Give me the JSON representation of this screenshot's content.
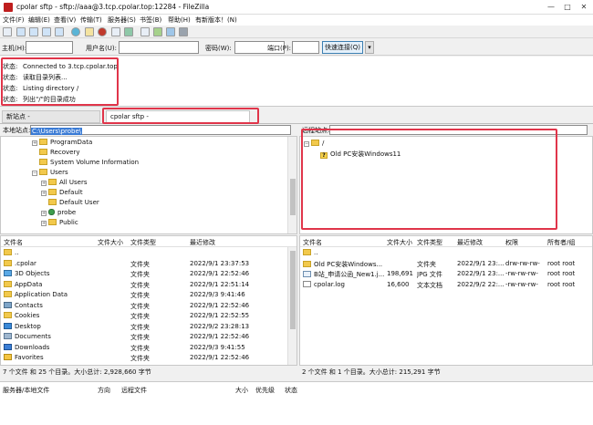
{
  "window": {
    "title": "cpolar sftp - sftp://aaa@3.tcp.cpolar.top:12284 - FileZilla",
    "controls": [
      "—",
      "□",
      "✕"
    ]
  },
  "menu": [
    "文件(F)",
    "编辑(E)",
    "查看(V)",
    "传输(T)",
    "服务器(S)",
    "书签(B)",
    "帮助(H)",
    "有新版本！(N)"
  ],
  "quickconnect": {
    "host_label": "主机(H):",
    "user_label": "用户名(U):",
    "pass_label": "密码(W):",
    "port_label": "端口(P):",
    "connect_label": "快速连接(Q)",
    "dropdown": "▾"
  },
  "log": [
    {
      "k": "状态:",
      "v": "Connected to 3.tcp.cpolar.top"
    },
    {
      "k": "状态:",
      "v": "读取目录列表..."
    },
    {
      "k": "状态:",
      "v": "Listing directory /"
    },
    {
      "k": "状态:",
      "v": "列出\"/\"的目录成功"
    }
  ],
  "tabs": [
    {
      "label": "新站点 - sftp://aaa@127.0.0.1",
      "active": false
    },
    {
      "label": "cpolar sftp - sftp://aaa@3.tcp.cpolar.top:12284",
      "active": true
    }
  ],
  "local": {
    "site_label": "本地站点:",
    "path": "C:\\Users\\probe\\",
    "tree": [
      {
        "name": "ProgramData",
        "indent": 1,
        "exp": "+"
      },
      {
        "name": "Recovery",
        "indent": 1,
        "exp": ""
      },
      {
        "name": "System Volume Information",
        "indent": 1,
        "exp": ""
      },
      {
        "name": "Users",
        "indent": 1,
        "exp": "−"
      },
      {
        "name": "All Users",
        "indent": 2,
        "exp": "+"
      },
      {
        "name": "Default",
        "indent": 2,
        "exp": "+"
      },
      {
        "name": "Default User",
        "indent": 2,
        "exp": ""
      },
      {
        "name": "probe",
        "indent": 2,
        "exp": "+",
        "user": true
      },
      {
        "name": "Public",
        "indent": 2,
        "exp": "+"
      }
    ],
    "columns": [
      "文件名",
      "文件大小",
      "文件类型",
      "最近修改"
    ],
    "files": [
      {
        "name": "..",
        "size": "",
        "type": "",
        "date": "",
        "icon": "folder"
      },
      {
        "name": ".cpolar",
        "size": "",
        "type": "文件夹",
        "date": "2022/9/1 23:37:53",
        "icon": "folder"
      },
      {
        "name": "3D Objects",
        "size": "",
        "type": "文件夹",
        "date": "2022/9/1 22:52:46",
        "icon": "obj3d"
      },
      {
        "name": "AppData",
        "size": "",
        "type": "文件夹",
        "date": "2022/9/1 22:51:14",
        "icon": "folder"
      },
      {
        "name": "Application Data",
        "size": "",
        "type": "文件夹",
        "date": "2022/9/3 9:41:46",
        "icon": "folder"
      },
      {
        "name": "Contacts",
        "size": "",
        "type": "文件夹",
        "date": "2022/9/1 22:52:46",
        "icon": "contacts"
      },
      {
        "name": "Cookies",
        "size": "",
        "type": "文件夹",
        "date": "2022/9/1 22:52:55",
        "icon": "folder"
      },
      {
        "name": "Desktop",
        "size": "",
        "type": "文件夹",
        "date": "2022/9/2 23:28:13",
        "icon": "desktop"
      },
      {
        "name": "Documents",
        "size": "",
        "type": "文件夹",
        "date": "2022/9/1 22:52:46",
        "icon": "docs"
      },
      {
        "name": "Downloads",
        "size": "",
        "type": "文件夹",
        "date": "2022/9/3 9:41:55",
        "icon": "download"
      },
      {
        "name": "Favorites",
        "size": "",
        "type": "文件夹",
        "date": "2022/9/1 22:52:46",
        "icon": "star"
      }
    ],
    "status": "7 个文件 和 25 个目录。大小总计: 2,928,660 字节"
  },
  "remote": {
    "site_label": "远程站点:",
    "path": "",
    "tree": [
      {
        "name": "/",
        "indent": 0,
        "exp": "−"
      },
      {
        "name": "Old PC安装Windows11",
        "indent": 1,
        "exp": "",
        "unknown": true
      }
    ],
    "columns": [
      "文件名",
      "文件大小",
      "文件类型",
      "最近修改",
      "权限",
      "所有者/组"
    ],
    "files": [
      {
        "name": "..",
        "size": "",
        "type": "",
        "date": "",
        "perm": "",
        "owner": "",
        "icon": "folder"
      },
      {
        "name": "Old PC安装Windows...",
        "size": "",
        "type": "文件夹",
        "date": "2022/9/1 23:...",
        "perm": "drw-rw-rw-",
        "owner": "root root",
        "icon": "folder"
      },
      {
        "name": "B站_申请公函_New1.j...",
        "size": "198,691",
        "type": "JPG 文件",
        "date": "2022/9/1 23:...",
        "perm": "-rw-rw-rw-",
        "owner": "root root",
        "icon": "image"
      },
      {
        "name": "cpolar.log",
        "size": "16,600",
        "type": "文本文档",
        "date": "2022/9/2 22:...",
        "perm": "-rw-rw-rw-",
        "owner": "root root",
        "icon": "file"
      }
    ],
    "status": "2 个文件 和 1 个目录。大小总计: 215,291 字节"
  },
  "queue": {
    "columns": [
      "服务器/本地文件",
      "方向",
      "远程文件",
      "大小",
      "优先级",
      "状态"
    ]
  },
  "highlight_color": "#e0354a"
}
